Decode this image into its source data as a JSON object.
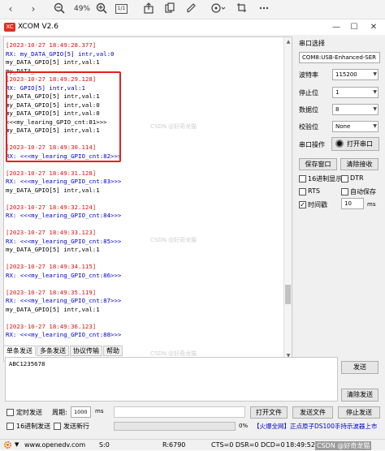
{
  "viewer": {
    "back_icon": "‹",
    "forward_icon": "›",
    "zoom_level": "49%",
    "page_indicator": "1/1"
  },
  "window": {
    "title": "XCOM V2.6",
    "logo_text": "XC"
  },
  "receive_log": [
    {
      "t": "ts",
      "text": "[2023-10-27 18:49:28.377]"
    },
    {
      "t": "rx",
      "text": "RX: my_DATA_GPIO[5] intr,val:0"
    },
    {
      "t": "pl",
      "text": "my_DATA_GPIO[5] intr,val:1"
    },
    {
      "t": "pl",
      "text": "my_DATA_"
    },
    {
      "t": "ts",
      "text": "[2023-10-27 18:49:29.128]"
    },
    {
      "t": "rx",
      "text": "RX: GPIO[5] intr,val:1"
    },
    {
      "t": "pl",
      "text": "my_DATA_GPIO[5] intr,val:1"
    },
    {
      "t": "pl",
      "text": "my_DATA_GPIO[5] intr,val:0"
    },
    {
      "t": "pl",
      "text": "my_DATA_GPIO[5] intr,val:0"
    },
    {
      "t": "pl",
      "text": "<<<my_learing_GPIO_cnt:81>>>"
    },
    {
      "t": "pl",
      "text": "my_DATA_GPIO[5] intr,val:1"
    },
    {
      "t": "gap",
      "text": ""
    },
    {
      "t": "ts",
      "text": "[2023-10-27 18:49:30.114]"
    },
    {
      "t": "rx",
      "text": "RX: <<<my_learing_GPIO_cnt:82>>>"
    },
    {
      "t": "gap",
      "text": ""
    },
    {
      "t": "ts",
      "text": "[2023-10-27 18:49:31.128]"
    },
    {
      "t": "rx",
      "text": "RX: <<<my_learing_GPIO_cnt:83>>>"
    },
    {
      "t": "pl",
      "text": "my_DATA_GPIO[5] intr,val:1"
    },
    {
      "t": "gap",
      "text": ""
    },
    {
      "t": "ts",
      "text": "[2023-10-27 18:49:32.124]"
    },
    {
      "t": "rx",
      "text": "RX: <<<my_learing_GPIO_cnt:84>>>"
    },
    {
      "t": "gap",
      "text": ""
    },
    {
      "t": "ts",
      "text": "[2023-10-27 18:49:33.123]"
    },
    {
      "t": "rx",
      "text": "RX: <<<my_learing_GPIO_cnt:85>>>"
    },
    {
      "t": "pl",
      "text": "my_DATA_GPIO[5] intr,val:1"
    },
    {
      "t": "gap",
      "text": ""
    },
    {
      "t": "ts",
      "text": "[2023-10-27 18:49:34.115]"
    },
    {
      "t": "rx",
      "text": "RX: <<<my_learing_GPIO_cnt:86>>>"
    },
    {
      "t": "gap",
      "text": ""
    },
    {
      "t": "ts",
      "text": "[2023-10-27 18:49:35.119]"
    },
    {
      "t": "rx",
      "text": "RX: <<<my_learing_GPIO_cnt:87>>>"
    },
    {
      "t": "pl",
      "text": "my_DATA_GPIO[5] intr,val:1"
    },
    {
      "t": "gap",
      "text": ""
    },
    {
      "t": "ts",
      "text": "[2023-10-27 18:49:36.123]"
    },
    {
      "t": "rx",
      "text": "RX: <<<my_learing_GPIO_cnt:88>>>"
    }
  ],
  "serial": {
    "section_title": "串口选择",
    "port_value": "COM8:USB-Enhanced-SER",
    "baud_label": "波特率",
    "baud_value": "115200",
    "stop_label": "停止位",
    "stop_value": "1",
    "data_label": "数据位",
    "data_value": "8",
    "parity_label": "校验位",
    "parity_value": "None",
    "op_label": "串口操作",
    "open_button": "打开串口"
  },
  "controls": {
    "save_window": "保存窗口",
    "clear_receive": "清除接收",
    "hex_display": "16进制显示",
    "dtr": "DTR",
    "rts": "RTS",
    "auto_save": "自动保存",
    "timestamp": "时间戳",
    "timestamp_value": "10",
    "ms_unit": "ms"
  },
  "send": {
    "tabs": [
      "单条发送",
      "多条发送",
      "协议传输",
      "帮助"
    ],
    "input_value": "ABC1235678",
    "send_button": "发送",
    "clear_send_button": "清除发送",
    "timed_send": "定时发送",
    "period_label": "周期:",
    "period_value": "1000",
    "period_unit": "ms",
    "hex_send": "16进制发送",
    "send_newline": "发送新行",
    "open_file": "打开文件",
    "send_file": "发送文件",
    "stop_send": "停止发送",
    "progress_text": "0%",
    "progress_fraction": 0,
    "promo_text": "【火爆全网】正点原子DS100手持示波器上市"
  },
  "statusbar": {
    "settings_icon": "gear-icon",
    "url": "www.openedv.com",
    "s_count": "S:0",
    "r_count": "R:6790",
    "lines": "CTS=0 DSR=0 DCD=0",
    "time": "18:49:52"
  },
  "watermark_text": "CSDN @好奇龙猫",
  "colors": {
    "timestamp": "#e01010",
    "rx": "#0000cc",
    "highlight": "#e02020"
  }
}
